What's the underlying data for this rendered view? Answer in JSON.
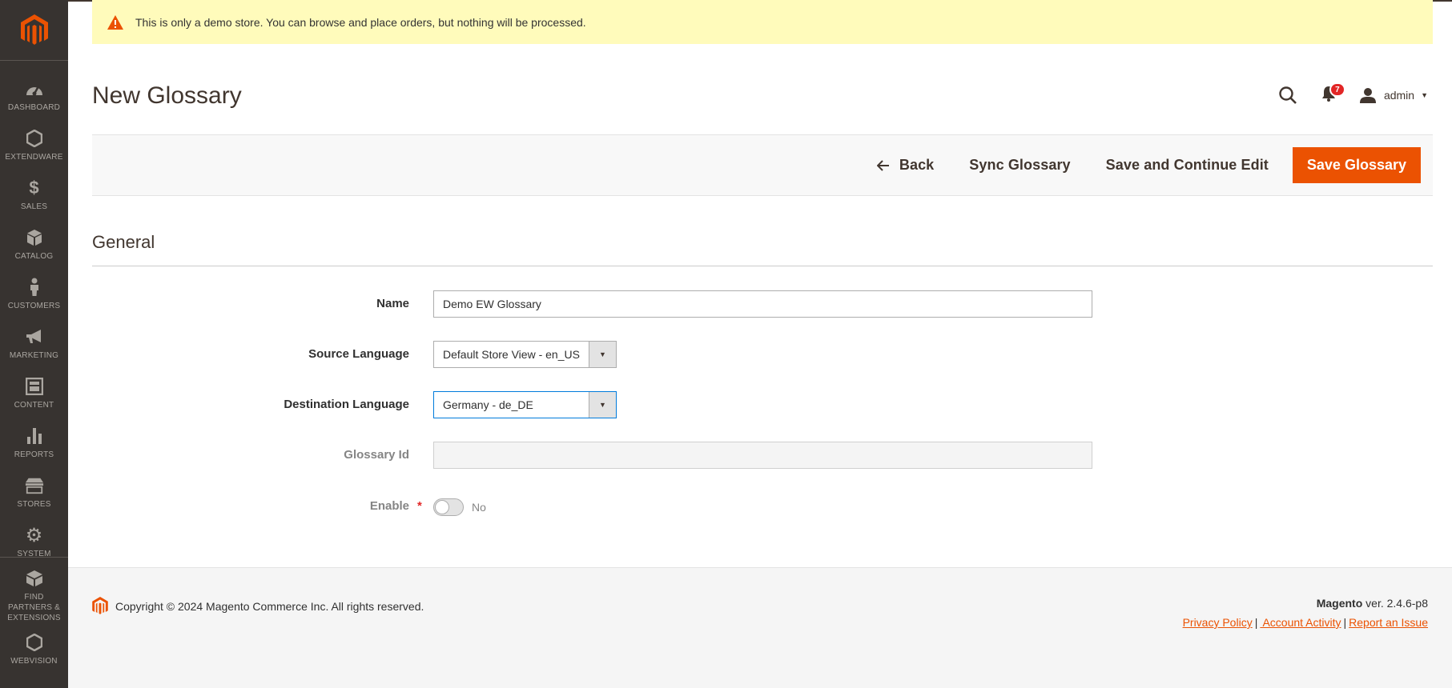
{
  "sidebar": {
    "items": [
      {
        "label": "DASHBOARD",
        "icon": "dashboard-icon"
      },
      {
        "label": "EXTENDWARE",
        "icon": "hexagon-icon"
      },
      {
        "label": "SALES",
        "icon": "dollar-icon"
      },
      {
        "label": "CATALOG",
        "icon": "box-icon"
      },
      {
        "label": "CUSTOMERS",
        "icon": "person-icon"
      },
      {
        "label": "MARKETING",
        "icon": "megaphone-icon"
      },
      {
        "label": "CONTENT",
        "icon": "layout-icon"
      },
      {
        "label": "REPORTS",
        "icon": "bar-chart-icon"
      },
      {
        "label": "STORES",
        "icon": "store-icon"
      },
      {
        "label": "SYSTEM",
        "icon": "gear-icon"
      },
      {
        "label": "FIND PARTNERS & EXTENSIONS",
        "icon": "boxes-icon"
      },
      {
        "label": "WEBVISION",
        "icon": "hexagon-icon"
      }
    ]
  },
  "notice": {
    "text": "This is only a demo store. You can browse and place orders, but nothing will be processed."
  },
  "header": {
    "title": "New Glossary",
    "notification_count": "7",
    "user": "admin"
  },
  "actions": {
    "back": "Back",
    "sync": "Sync Glossary",
    "save_continue": "Save and Continue Edit",
    "save": "Save Glossary"
  },
  "form": {
    "section_title": "General",
    "name": {
      "label": "Name",
      "value": "Demo EW Glossary"
    },
    "source_language": {
      "label": "Source Language",
      "value": "Default Store View - en_US"
    },
    "destination_language": {
      "label": "Destination Language",
      "value": "Germany - de_DE"
    },
    "glossary_id": {
      "label": "Glossary Id",
      "value": ""
    },
    "enable": {
      "label": "Enable",
      "required_mark": "*",
      "value": "No"
    }
  },
  "footer": {
    "copyright": "Copyright © 2024 Magento Commerce Inc. All rights reserved.",
    "brand": "Magento",
    "version": " ver. 2.4.6-p8",
    "links": [
      "Privacy Policy",
      " Account Activity",
      "Report an Issue"
    ],
    "separator": "|"
  },
  "colors": {
    "accent": "#eb5202",
    "sidebar": "#373330",
    "notice": "#fffbbb"
  }
}
